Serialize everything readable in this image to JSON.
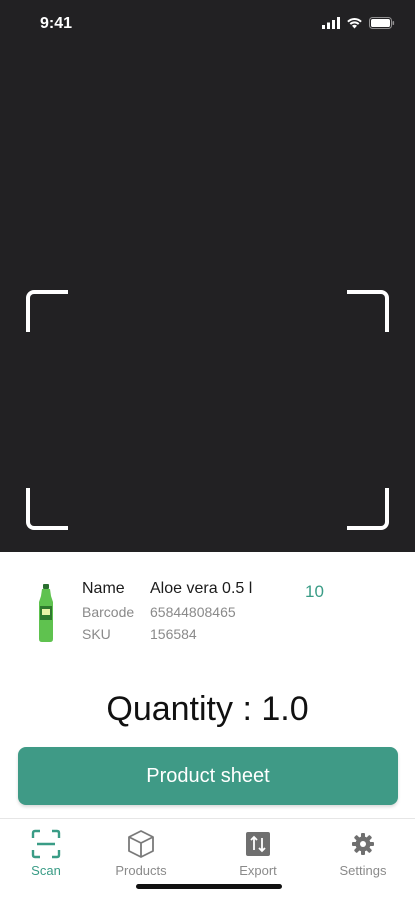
{
  "status_bar": {
    "time": "9:41"
  },
  "product": {
    "name_label": "Name",
    "name_value": "Aloe vera 0.5 l",
    "barcode_label": "Barcode",
    "barcode_value": "65844808465",
    "sku_label": "SKU",
    "sku_value": "156584",
    "count": "10",
    "image": "aloe-vera-bottle"
  },
  "quantity_text": "Quantity : 1.0",
  "product_sheet_button": "Product sheet",
  "tabs": [
    {
      "label": "Scan",
      "icon": "scan-icon",
      "active": true
    },
    {
      "label": "Products",
      "icon": "box-icon",
      "active": false
    },
    {
      "label": "Export",
      "icon": "export-icon",
      "active": false
    },
    {
      "label": "Settings",
      "icon": "gear-icon",
      "active": false
    }
  ],
  "colors": {
    "accent": "#3f9a86",
    "camera_bg": "#222123"
  }
}
